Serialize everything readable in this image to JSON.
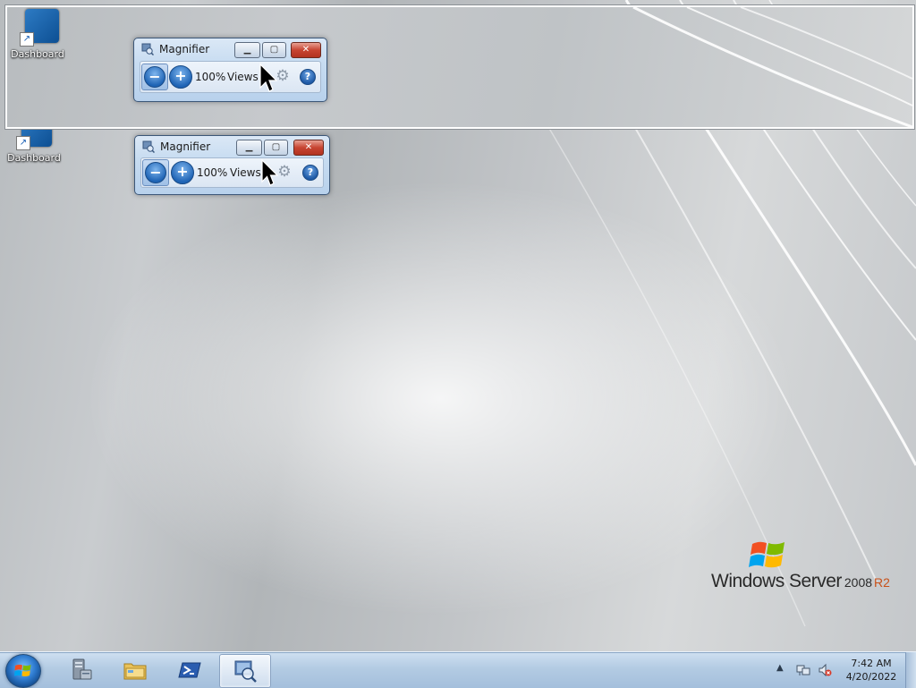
{
  "desktop": {
    "icons": [
      {
        "label": "Dashboard",
        "icon": "dashboard-gauge-icon"
      },
      {
        "label": "Dashboard",
        "icon": "dashboard-gauge-icon"
      }
    ]
  },
  "magnifier_lens": {
    "window": {
      "title": "Magnifier",
      "zoom_level": "100%",
      "views_label": "Views",
      "minimize_glyph": "▁",
      "maximize_glyph": "▢",
      "close_glyph": "✕",
      "zoom_out_glyph": "−",
      "zoom_in_glyph": "+",
      "help_glyph": "?",
      "options_glyph": "⚙"
    }
  },
  "magnifier_window": {
    "title": "Magnifier",
    "zoom_level": "100%",
    "views_label": "Views",
    "minimize_glyph": "▁",
    "maximize_glyph": "▢",
    "close_glyph": "✕",
    "zoom_out_glyph": "−",
    "zoom_in_glyph": "+",
    "help_glyph": "?",
    "options_glyph": "⚙"
  },
  "branding": {
    "product_name": "Windows Server",
    "version": "2008",
    "edition": "R2"
  },
  "taskbar": {
    "pinned": [
      {
        "name": "server-manager",
        "icon": "server-manager-icon"
      },
      {
        "name": "windows-explorer",
        "icon": "folder-icon"
      },
      {
        "name": "powershell",
        "icon": "powershell-icon"
      },
      {
        "name": "magnifier",
        "icon": "magnifier-icon",
        "active": true
      }
    ],
    "tray": {
      "show_hidden_glyph": "▲",
      "clock_time": "7:42 AM",
      "clock_date": "4/20/2022"
    }
  },
  "colors": {
    "taskbar": "#b3cbe3",
    "close_button": "#c74431",
    "accent_blue": "#1f64b5",
    "brand_r2": "#c8511a"
  }
}
